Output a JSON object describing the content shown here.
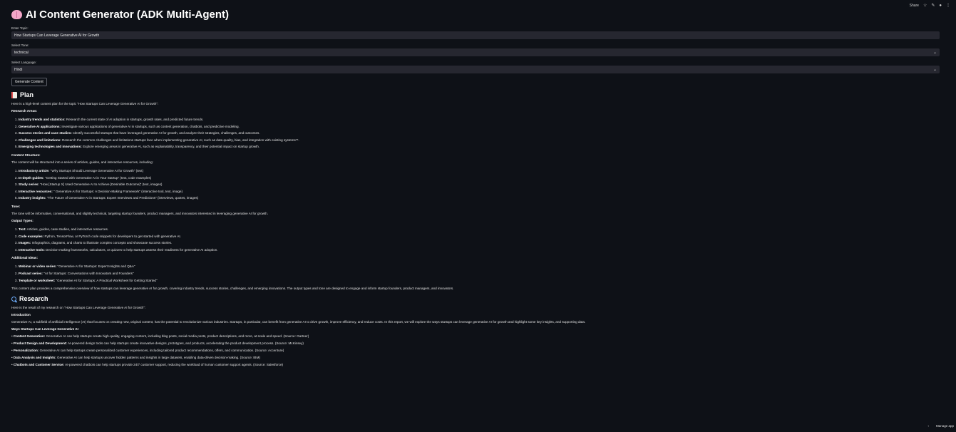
{
  "topbar": {
    "share_label": "Share",
    "star_icon": "star-icon",
    "edit_icon": "pencil-icon",
    "github_icon": "github-icon",
    "menu_icon": "kebab-menu-icon"
  },
  "app": {
    "title": "AI Content Generator (ADK Multi-Agent)",
    "title_icon": "brain-icon"
  },
  "form": {
    "topic_label": "Enter Topic:",
    "topic_value": "How Startups Can Leverage Generative AI for Growth",
    "tone_label": "Select Tone:",
    "tone_value": "technical",
    "language_label": "Select Language:",
    "language_value": "Hindi",
    "generate_label": "Generate Content"
  },
  "plan": {
    "heading": "Plan",
    "intro": "Here is a high-level content plan for the topic \"How Startups Can Leverage Generative AI for Growth\":",
    "research_areas_title": "Research Areas:",
    "research_areas": [
      {
        "b": "Industry trends and statistics:",
        "t": " Research the current state of AI adoption in startups, growth rates, and predicted future trends."
      },
      {
        "b": "Generative AI applications:",
        "t": " Investigate various applications of generative AI in startups, such as content generation, chatbots, and predictive modeling."
      },
      {
        "b": "Success stories and case studies:",
        "t": " Identify successful startups that have leveraged generative AI for growth, and analyze their strategies, challenges, and outcomes."
      },
      {
        "b": "Challenges and limitations:",
        "t": " Research the common challenges and limitations startups face when implementing generative AI, such as data quality, bias, and integration with existing systems**."
      },
      {
        "b": "Emerging technologies and innovations:",
        "t": " Explore emerging areas in generative AI, such as explainability, transparency, and their potential impact on startup growth."
      }
    ],
    "content_structure_title": "Content Structure:",
    "content_structure_intro": "The content will be structured into a series of articles, guides, and interactive resources, including:",
    "content_structure": [
      {
        "b": "Introductory article:",
        "t": " \"Why Startups Should Leverage Generative AI for Growth\" (text)"
      },
      {
        "b": "In-depth guides:",
        "t": " \"Getting Started with Generative AI in Your Startup\" (text, code examples)"
      },
      {
        "b": "Study series:",
        "t": " \"How [Startup X] Used Generative AI to Achieve [Desirable Outcome]\" (text, images)"
      },
      {
        "b": "Interactive resources:",
        "t": " \" Generative AI for Startups: A Decision-Making Framework\" (interactive tool, text, image)"
      },
      {
        "b": "Industry insights:",
        "t": " \"The Future of Generative AI in Startups: Expert Interviews and Predictions\" (interviews, quotes, images)"
      }
    ],
    "tone_title": "Tone:",
    "tone_text": "The tone will be informative, conversational, and slightly technical, targeting startup founders, product managers, and innovators interested in leveraging generative AI for growth.",
    "output_types_title": "Output Types:",
    "output_types": [
      {
        "b": "Text:",
        "t": " Articles, guides, case studies, and interactive resources."
      },
      {
        "b": "Code examples:",
        "t": " Python, TensorFlow, or PyTorch code snippets for developers to get started with generative AI."
      },
      {
        "b": "Images:",
        "t": " Infographics, diagrams, and charts to illustrate complex concepts and showcase success stories."
      },
      {
        "b": "Interactive tools:",
        "t": " Decision-making frameworks, calculators, or quizzes to help startups assess their readiness for generative AI adoption."
      }
    ],
    "additional_title": "Additional Ideas:",
    "additional": [
      {
        "b": "Webinar or video series:",
        "t": " \"Generative AI for Startups: Expert Insights and Q&A\""
      },
      {
        "b": "Podcast series:",
        "t": " \"AI for Startups: Conversations with Innovators and Founders\""
      },
      {
        "b": "Template or worksheet:",
        "t": " \"Generative AI for Startups: A Practical Worksheet for Getting Started\""
      }
    ],
    "closing": "This content plan provides a comprehensive overview of how startups can leverage generative AI for growth, covering industry trends, success stories, challenges, and emerging innovations. The output types and tone are designed to engage and inform startup founders, product managers, and innovators."
  },
  "research": {
    "heading": "Research",
    "intro": "Here is the result of my research on \"How Startups Can Leverage Generative AI for Growth\":",
    "introduction_title": "Introduction",
    "introduction_text": "Generative AI, a subfield of artificial intelligence (AI) that focuses on creating new, original content, has the potential to revolutionize various industries. Startups, in particular, can benefit from generative AI to drive growth, improve efficiency, and reduce costs. In this report, we will explore the ways startups can leverage generative AI for growth and highlight some key insights, and supporting data.",
    "ways_title": "Ways Startups Can Leverage Generative AI",
    "ways": [
      {
        "b": "Content Generation:",
        "t": " Generative AI can help startups create high-quality, engaging content, including blog posts, social media posts, product descriptions, and more, at scale and speed. (Source: Gartner)"
      },
      {
        "b": "Product Design and Development:",
        "t": " AI-powered design tools can help startups create innovative designs, prototypes, and products, accelerating the product development process. (Source: McKinsey)"
      },
      {
        "b": "Personalization:",
        "t": " Generative AI can help startups create personalized customer experiences, including tailored product recommendations, offers, and communication. (Source: Accenture)"
      },
      {
        "b": "Data Analysis and Insights:",
        "t": " Generative AI can help startups uncover hidden patterns and insights in large datasets, enabling data-driven decision-making. (Source: IBM)"
      },
      {
        "b": "Chatbots and Customer Service:",
        "t": " AI-powered chatbots can help startups provide 24/7 customer support, reducing the workload of human customer support agents. (Source: Salesforce)"
      }
    ]
  },
  "footer": {
    "manage_label": "Manage app"
  }
}
